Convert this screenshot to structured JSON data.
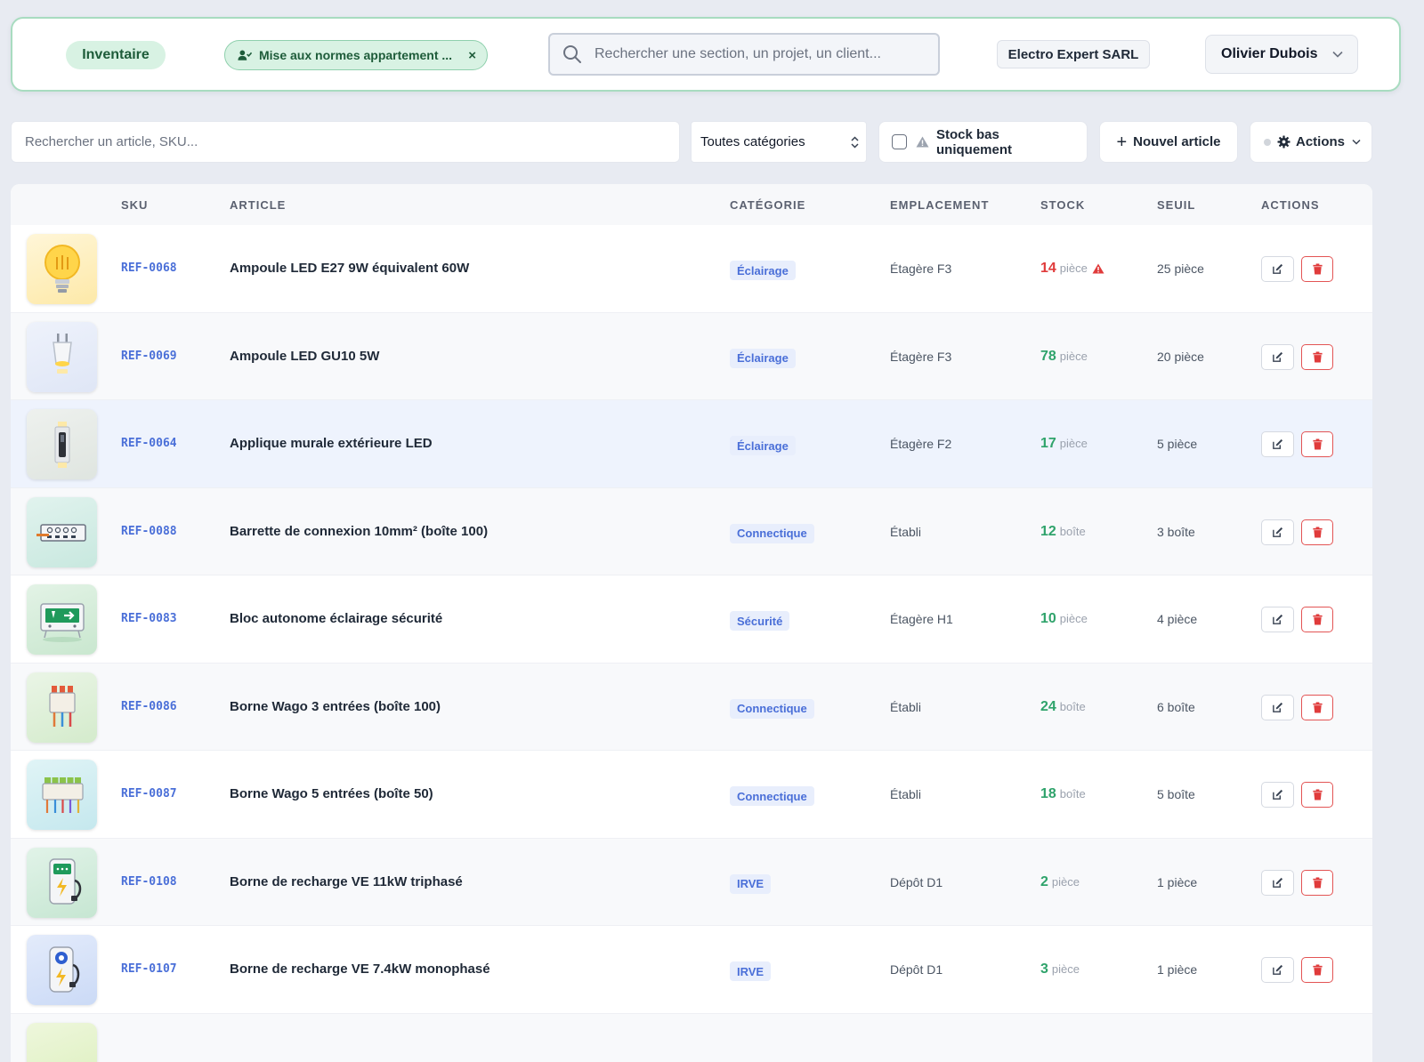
{
  "header": {
    "section_label": "Inventaire",
    "project_chip": "Mise aux normes appartement ...",
    "project_chip_close": "×",
    "search_placeholder": "Rechercher une section, un projet, un client...",
    "company": "Electro Expert SARL",
    "user": "Olivier Dubois"
  },
  "toolbar": {
    "search_placeholder": "Rechercher un article, SKU...",
    "category_value": "Toutes catégories",
    "lowstock_label": "Stock bas uniquement",
    "lowstock_checked": false,
    "new_article_label": "Nouvel article",
    "actions_label": "Actions"
  },
  "table": {
    "columns": {
      "sku": "SKU",
      "article": "ARTICLE",
      "category": "CATÉGORIE",
      "location": "EMPLACEMENT",
      "stock": "STOCK",
      "threshold": "SEUIL",
      "actions": "ACTIONS"
    },
    "rows": [
      {
        "thumb": "bulb-e27-icon",
        "sku": "REF-0068",
        "name": "Ampoule LED E27 9W équivalent 60W",
        "category": "Éclairage",
        "location": "Étagère F3",
        "stock": "14",
        "stock_unit": "pièce",
        "low": true,
        "threshold": "25 pièce"
      },
      {
        "thumb": "bulb-gu10-icon",
        "sku": "REF-0069",
        "name": "Ampoule LED GU10 5W",
        "category": "Éclairage",
        "location": "Étagère F3",
        "stock": "78",
        "stock_unit": "pièce",
        "low": false,
        "threshold": "20 pièce"
      },
      {
        "thumb": "wall-light-icon",
        "sku": "REF-0064",
        "name": "Applique murale extérieure LED",
        "category": "Éclairage",
        "location": "Étagère F2",
        "stock": "17",
        "stock_unit": "pièce",
        "low": false,
        "threshold": "5 pièce"
      },
      {
        "thumb": "terminal-strip-icon",
        "sku": "REF-0088",
        "name": "Barrette de connexion 10mm² (boîte 100)",
        "category": "Connectique",
        "location": "Établi",
        "stock": "12",
        "stock_unit": "boîte",
        "low": false,
        "threshold": "3 boîte"
      },
      {
        "thumb": "emergency-light-icon",
        "sku": "REF-0083",
        "name": "Bloc autonome éclairage sécurité",
        "category": "Sécurité",
        "location": "Étagère H1",
        "stock": "10",
        "stock_unit": "pièce",
        "low": false,
        "threshold": "4 pièce"
      },
      {
        "thumb": "wago-3-icon",
        "sku": "REF-0086",
        "name": "Borne Wago 3 entrées (boîte 100)",
        "category": "Connectique",
        "location": "Établi",
        "stock": "24",
        "stock_unit": "boîte",
        "low": false,
        "threshold": "6 boîte"
      },
      {
        "thumb": "wago-5-icon",
        "sku": "REF-0087",
        "name": "Borne Wago 5 entrées (boîte 50)",
        "category": "Connectique",
        "location": "Établi",
        "stock": "18",
        "stock_unit": "boîte",
        "low": false,
        "threshold": "5 boîte"
      },
      {
        "thumb": "ev-charger-tri-icon",
        "sku": "REF-0108",
        "name": "Borne de recharge VE 11kW triphasé",
        "category": "IRVE",
        "location": "Dépôt D1",
        "stock": "2",
        "stock_unit": "pièce",
        "low": false,
        "threshold": "1 pièce"
      },
      {
        "thumb": "ev-charger-mono-icon",
        "sku": "REF-0107",
        "name": "Borne de recharge VE 7.4kW monophasé",
        "category": "IRVE",
        "location": "Dépôt D1",
        "stock": "3",
        "stock_unit": "pièce",
        "low": false,
        "threshold": "1 pièce"
      }
    ]
  },
  "colors": {
    "accent_green": "#2fa36b",
    "low_red": "#e03b3b",
    "sku_blue": "#4a6fd8",
    "header_border": "#a8dcc0"
  }
}
